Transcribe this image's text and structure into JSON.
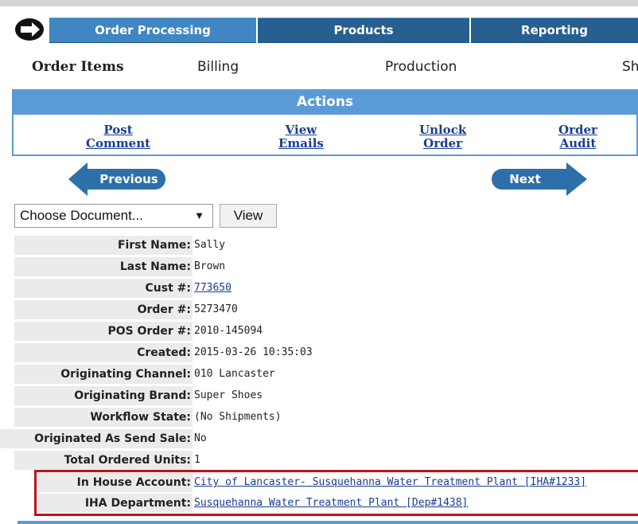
{
  "nav": {
    "tabs": [
      "Order Processing",
      "Products",
      "Reporting"
    ]
  },
  "subtabs": [
    "Order Items",
    "Billing",
    "Production",
    "Sh"
  ],
  "actions": {
    "header": "Actions",
    "links": [
      {
        "line1": "Post",
        "line2": "Comment"
      },
      {
        "line1": "View",
        "line2": "Emails"
      },
      {
        "line1": "Unlock",
        "line2": "Order"
      },
      {
        "line1": "Order",
        "line2": "Audit"
      }
    ]
  },
  "pager": {
    "previous": "Previous",
    "next": "Next"
  },
  "document": {
    "selected": "Choose Document...",
    "view_label": "View"
  },
  "details": [
    {
      "label": "First Name:",
      "value": "Sally"
    },
    {
      "label": "Last Name:",
      "value": "Brown"
    },
    {
      "label": "Cust #:",
      "value": "773650",
      "link": true
    },
    {
      "label": "Order #:",
      "value": "5273470"
    },
    {
      "label": "POS Order #:",
      "value": "2010-145094"
    },
    {
      "label": "Created:",
      "value": "2015-03-26 10:35:03"
    },
    {
      "label": "Originating Channel:",
      "value": "010 Lancaster"
    },
    {
      "label": "Originating Brand:",
      "value": "Super Shoes"
    },
    {
      "label": "Workflow State:",
      "value": "(No Shipments)"
    },
    {
      "label": "Originated As Send Sale:",
      "value": "No"
    },
    {
      "label": "Total Ordered Units:",
      "value": "1"
    },
    {
      "label": "In House Account:",
      "value": "City of Lancaster- Susquehanna Water Treatment Plant [IHA#1233]",
      "link": true
    },
    {
      "label": "IHA Department:",
      "value": "Susquehanna Water Treatment Plant [Dep#1438]",
      "link": true
    }
  ]
}
